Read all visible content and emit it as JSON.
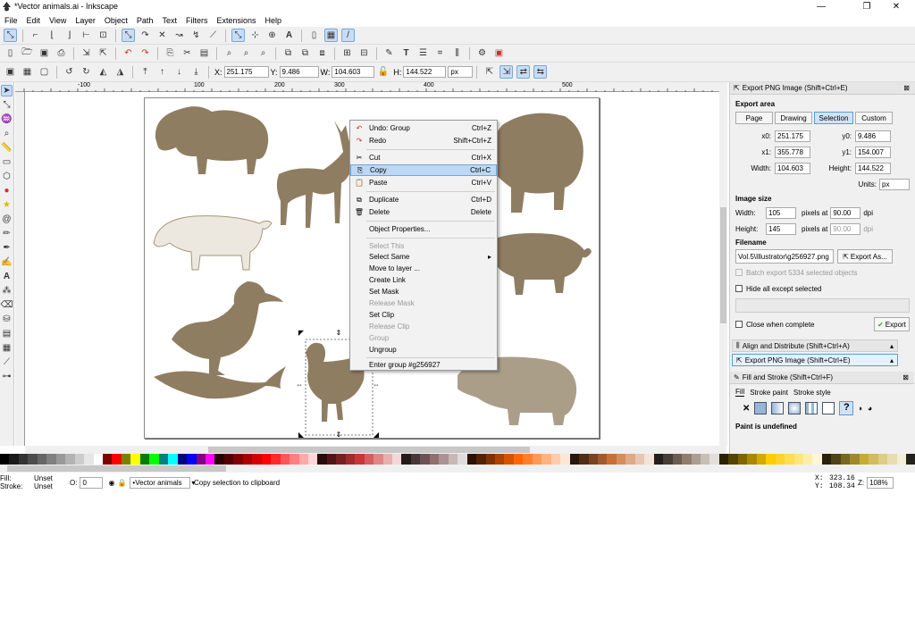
{
  "window": {
    "title": "*Vector animals.ai - Inkscape",
    "minimize": "—",
    "maximize": "❐",
    "close": "✕"
  },
  "menu": [
    "File",
    "Edit",
    "View",
    "Layer",
    "Object",
    "Path",
    "Text",
    "Filters",
    "Extensions",
    "Help"
  ],
  "coords": {
    "x_label": "X:",
    "x": "251.175",
    "y_label": "Y:",
    "y": "9.486",
    "w_label": "W:",
    "w": "104.603",
    "h_label": "H:",
    "h": "144.522",
    "unit": "px"
  },
  "rulers": {
    "top": [
      "-100",
      "100",
      "200",
      "300",
      "400",
      "500"
    ]
  },
  "context_menu": {
    "items": [
      {
        "icon": "↶",
        "label": "Undo: Group",
        "shortcut": "Ctrl+Z",
        "disabled": false
      },
      {
        "icon": "↷",
        "label": "Redo",
        "shortcut": "Shift+Ctrl+Z",
        "disabled": false
      },
      {
        "icon": "✂",
        "label": "Cut",
        "shortcut": "Ctrl+X",
        "disabled": false
      },
      {
        "icon": "⎘",
        "label": "Copy",
        "shortcut": "Ctrl+C",
        "disabled": false,
        "highlighted": true
      },
      {
        "icon": "📋",
        "label": "Paste",
        "shortcut": "Ctrl+V",
        "disabled": false
      },
      {
        "icon": "⧉",
        "label": "Duplicate",
        "shortcut": "Ctrl+D",
        "disabled": false
      },
      {
        "icon": "🗑",
        "label": "Delete",
        "shortcut": "Delete",
        "disabled": false
      },
      {
        "icon": "",
        "label": "Object Properties...",
        "shortcut": "",
        "disabled": false
      },
      {
        "icon": "",
        "label": "Select This",
        "shortcut": "",
        "disabled": true
      },
      {
        "icon": "",
        "label": "Select Same",
        "shortcut": "▸",
        "disabled": false
      },
      {
        "icon": "",
        "label": "Move to layer ...",
        "shortcut": "",
        "disabled": false
      },
      {
        "icon": "",
        "label": "Create Link",
        "shortcut": "",
        "disabled": false
      },
      {
        "icon": "",
        "label": "Set Mask",
        "shortcut": "",
        "disabled": false
      },
      {
        "icon": "",
        "label": "Release Mask",
        "shortcut": "",
        "disabled": true
      },
      {
        "icon": "",
        "label": "Set Clip",
        "shortcut": "",
        "disabled": false
      },
      {
        "icon": "",
        "label": "Release Clip",
        "shortcut": "",
        "disabled": true
      },
      {
        "icon": "",
        "label": "Group",
        "shortcut": "",
        "disabled": true
      },
      {
        "icon": "",
        "label": "Ungroup",
        "shortcut": "",
        "disabled": false
      },
      {
        "icon": "",
        "label": "Enter group #g256927",
        "shortcut": "",
        "disabled": false
      }
    ]
  },
  "export": {
    "header": "Export PNG Image (Shift+Ctrl+E)",
    "area_title": "Export area",
    "area_tabs": [
      "Page",
      "Drawing",
      "Selection",
      "Custom"
    ],
    "active_tab": "Selection",
    "x0_label": "x0:",
    "x0": "251.175",
    "y0_label": "y0:",
    "y0": "9.486",
    "x1_label": "x1:",
    "x1": "355.778",
    "y1_label": "y1:",
    "y1": "154.007",
    "width_label": "Width:",
    "width": "104.603",
    "height_label": "Height:",
    "height": "144.522",
    "units_label": "Units:",
    "units": "px",
    "size_title": "Image size",
    "img_width_label": "Width:",
    "img_width": "105",
    "img_height_label": "Height:",
    "img_height": "145",
    "dpi_label": "pixels at",
    "dpi": "90.00",
    "dpi_unit": "dpi",
    "dpi2": "90.00",
    "dpi_unit2": "dpi",
    "filename_title": "Filename",
    "filename": "Vol.5\\Illustrator\\g256927.png",
    "export_as": "Export As...",
    "batch": "Batch export 5334 selected objects",
    "hide_all": "Hide all except selected",
    "close_when": "Close when complete",
    "export_btn": "Export"
  },
  "dock_tabs": {
    "align": "Align and Distribute (Shift+Ctrl+A)",
    "export": "Export PNG Image (Shift+Ctrl+E)",
    "fill": "Fill and Stroke (Shift+Ctrl+F)"
  },
  "fill_panel": {
    "tabs": [
      "Fill",
      "Stroke paint",
      "Stroke style"
    ],
    "undefined": "Paint is undefined",
    "x_icon": "✕",
    "unset_icon": "?"
  },
  "status": {
    "fill_label": "Fill:",
    "fill": "Unset",
    "stroke_label": "Stroke:",
    "stroke": "Unset",
    "opacity_label": "O:",
    "opacity": "0",
    "layer": "•Vector animals",
    "message": "Copy selection to clipboard",
    "cx_label": "X:",
    "cx": "323.16",
    "cy_label": "Y:",
    "cy": "108.34",
    "zoom_label": "Z:",
    "zoom": "108%"
  },
  "palette": [
    "#000000",
    "#1a1a1a",
    "#333333",
    "#4d4d4d",
    "#666666",
    "#808080",
    "#999999",
    "#b3b3b3",
    "#cccccc",
    "#e6e6e6",
    "#ffffff",
    "#800000",
    "#ff0000",
    "#808000",
    "#ffff00",
    "#008000",
    "#00ff00",
    "#008080",
    "#00ffff",
    "#000080",
    "#0000ff",
    "#800080",
    "#ff00ff",
    "#2b0000",
    "#550000",
    "#800000",
    "#aa0000",
    "#d40000",
    "#ff0000",
    "#ff2a2a",
    "#ff5555",
    "#ff8080",
    "#ffaaaa",
    "#ffd5d5",
    "#280b0b",
    "#501616",
    "#782121",
    "#a02c2c",
    "#c83737",
    "#d35f5f",
    "#de8787",
    "#e9afaf",
    "#f4d7d7",
    "#241c1c",
    "#483737",
    "#6c5353",
    "#916f6f",
    "#ac9393",
    "#c8b7b7",
    "#e3dbdb",
    "#2b1100",
    "#552200",
    "#803300",
    "#aa4400",
    "#d45500",
    "#ff6600",
    "#ff7f2a",
    "#ff9955",
    "#ffb380",
    "#ffccaa",
    "#ffe6d5",
    "#28170b",
    "#502d16",
    "#784421",
    "#a05a2c",
    "#c87137",
    "#d38d5f",
    "#deaa87",
    "#e9c6af",
    "#f4e3d7",
    "#241f1c",
    "#483e37",
    "#6c5d53",
    "#917c6f",
    "#ac9d93",
    "#c8beb7",
    "#e3dedb",
    "#2b2200",
    "#554400",
    "#806600",
    "#aa8800",
    "#d4aa00",
    "#ffcc00",
    "#ffd42a",
    "#ffdd55",
    "#ffe680",
    "#ffeeaa",
    "#fff6d5",
    "#28220b",
    "#504416",
    "#786721",
    "#a0892c",
    "#c8ab37",
    "#d3bc5f",
    "#decd87",
    "#e9ddaf",
    "#f4eed7",
    "#24221c"
  ]
}
